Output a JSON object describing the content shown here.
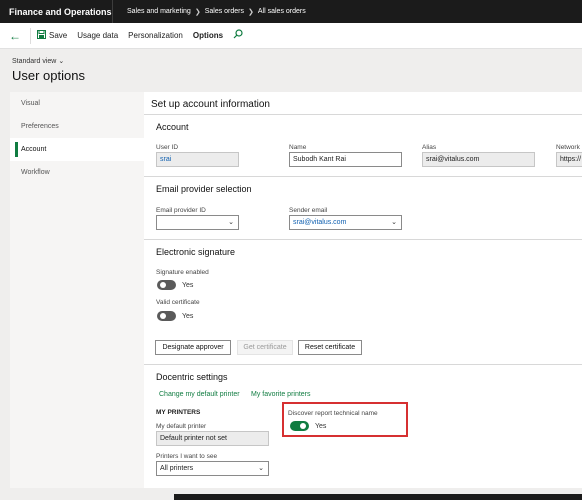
{
  "app": {
    "title": "Finance and Operations"
  },
  "breadcrumb": [
    "Sales and marketing",
    "Sales orders",
    "All sales orders"
  ],
  "toolbar": {
    "save_label": "Save",
    "usage_data_label": "Usage data",
    "personalization_label": "Personalization",
    "options_label": "Options"
  },
  "page": {
    "view_label": "Standard view",
    "title": "User options",
    "section_title": "Set up account information"
  },
  "tabs": [
    {
      "label": "Visual"
    },
    {
      "label": "Preferences"
    },
    {
      "label": "Account"
    },
    {
      "label": "Workflow"
    }
  ],
  "active_tab": "Account",
  "account": {
    "heading": "Account",
    "user_id_label": "User ID",
    "user_id": "srai",
    "name_label": "Name",
    "name": "Subodh Kant Rai",
    "alias_label": "Alias",
    "alias": "srai@vitalus.com",
    "network_label": "Network",
    "network_value": "https://"
  },
  "email_provider": {
    "heading": "Email provider selection",
    "provider_id_label": "Email provider ID",
    "provider_id": "",
    "sender_email_label": "Sender email",
    "sender_email": "srai@vitalus.com"
  },
  "esignature": {
    "heading": "Electronic signature",
    "signature_enabled_label": "Signature enabled",
    "signature_enabled_value": "Yes",
    "valid_certificate_label": "Valid certificate",
    "valid_certificate_value": "Yes",
    "designate_approver_label": "Designate approver",
    "get_certificate_label": "Get certificate",
    "reset_certificate_label": "Reset certificate"
  },
  "docentric": {
    "heading": "Docentric settings",
    "link_default_printer": "Change my default printer",
    "link_favorite_printers": "My favorite printers",
    "my_printers_heading": "MY PRINTERS",
    "default_printer_label": "My default printer",
    "default_printer_value": "Default printer not set",
    "printers_to_see_label": "Printers I want to see",
    "printers_to_see_value": "All printers",
    "discover_label": "Discover report technical name",
    "discover_value": "Yes"
  },
  "colors": {
    "accent": "#107c41",
    "topbar": "#1b1b1b",
    "highlight": "#d63031",
    "link": "#1060b0"
  },
  "icons": {
    "back": "back-arrow-icon",
    "save": "save-icon",
    "search": "search-icon",
    "chevron": "chevron-down-icon"
  }
}
